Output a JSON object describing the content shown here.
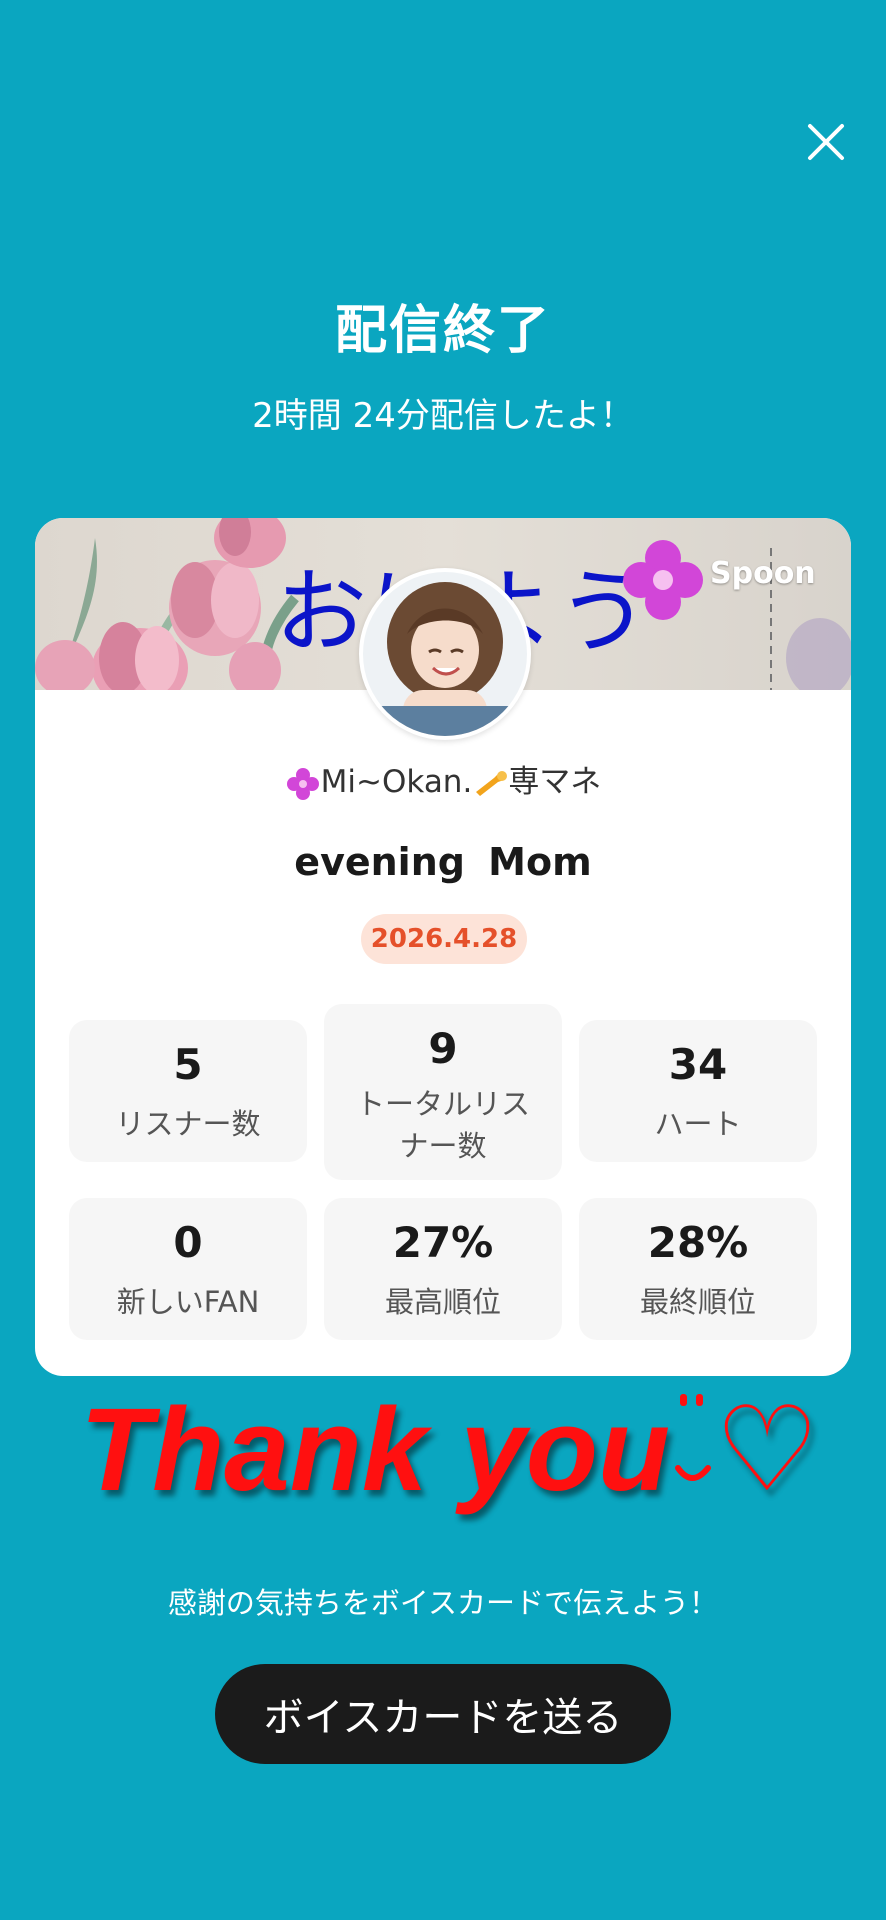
{
  "header": {
    "close_icon": "close-icon",
    "title": "配信終了",
    "subtitle": "2時間 24分配信したよ！"
  },
  "card": {
    "banner_text": "おはよう",
    "brand": "Spoon",
    "broadcaster_name": "Mi~Okan.",
    "broadcaster_suffix": "専マネ",
    "stream_title": "evening  Mom",
    "date": "2026.4.28",
    "stats": [
      {
        "value": "5",
        "label": "リスナー数"
      },
      {
        "value": "9",
        "label": "トータルリスナー数"
      },
      {
        "value": "34",
        "label": "ハート"
      },
      {
        "value": "0",
        "label": "新しいFAN"
      },
      {
        "value": "27%",
        "label": "最高順位"
      },
      {
        "value": "28%",
        "label": "最終順位"
      }
    ]
  },
  "overlay": {
    "thank_you": "Thank you",
    "heart": "♡"
  },
  "footer": {
    "prompt": "感謝の気持ちをボイスカードで伝えよう！",
    "cta_label": "ボイスカードを送る"
  },
  "colors": {
    "background": "#0aa6c0",
    "date_badge_bg": "#fde3d8",
    "date_badge_text": "#e5502a",
    "thank_you": "#ff1010",
    "cta_bg": "#1b1b1b"
  }
}
